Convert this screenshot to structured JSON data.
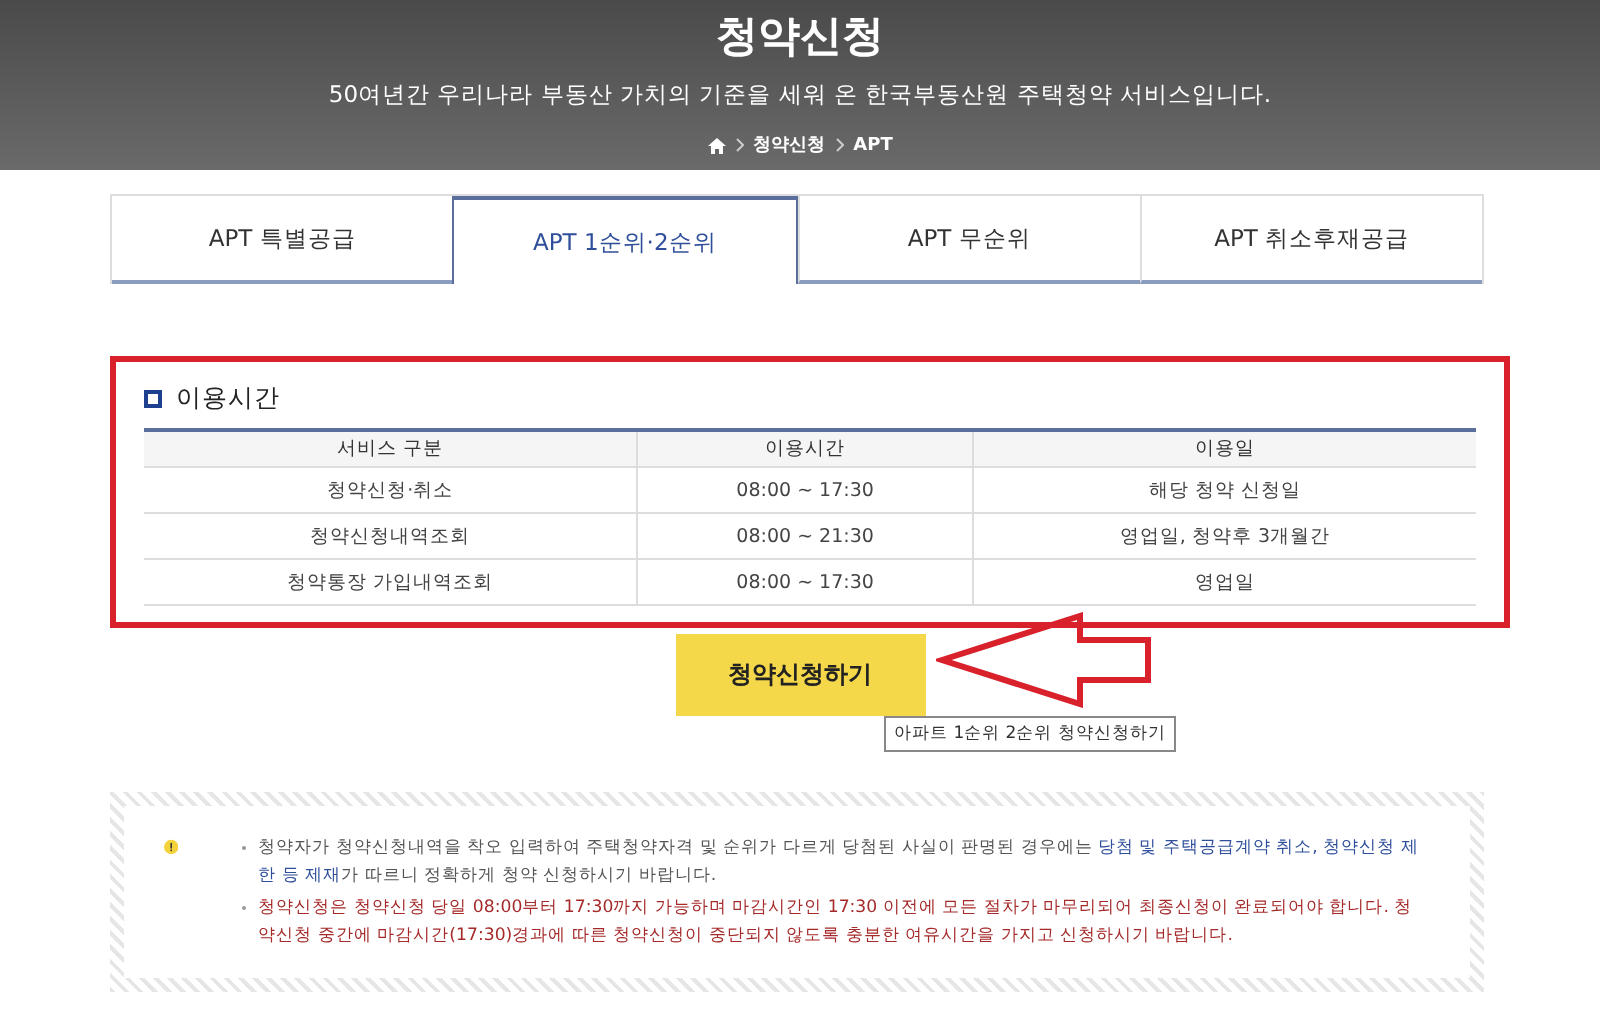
{
  "header": {
    "title": "청약신청",
    "subtitle": "50여년간 우리나라 부동산 가치의 기준을 세워 온 한국부동산원 주택청약 서비스입니다.",
    "breadcrumb": [
      "청약신청",
      "APT"
    ]
  },
  "tabs": [
    {
      "label": "APT 특별공급",
      "selected": false
    },
    {
      "label": "APT 1순위·2순위",
      "selected": true
    },
    {
      "label": "APT 무순위",
      "selected": false
    },
    {
      "label": "APT 취소후재공급",
      "selected": false
    }
  ],
  "usage": {
    "title": "이용시간",
    "columns": [
      "서비스 구분",
      "이용시간",
      "이용일"
    ],
    "rows": [
      [
        "청약신청·취소",
        "08:00 ~ 17:30",
        "해당 청약 신청일"
      ],
      [
        "청약신청내역조회",
        "08:00 ~ 21:30",
        "영업일, 청약후 3개월간"
      ],
      [
        "청약통장 가입내역조회",
        "08:00 ~ 17:30",
        "영업일"
      ]
    ]
  },
  "apply_button": "청약신청하기",
  "tooltip": "아파트 1순위 2순위 청약신청하기",
  "notices": [
    {
      "kind": "normal",
      "text": "청약자가 청약신청내역을 착오 입력하여 주택청약자격 및 순위가 다르게 당첨된 사실이 판명된 경우에는 **당첨 및 주택공급계약 취소, 청약신청 제한 등 제재**가 따르니 정확하게 청약 신청하시기 바랍니다."
    },
    {
      "kind": "warning",
      "text": "청약신청은 청약신청 당일 08:00부터 17:30까지 가능하며 마감시간인 17:30 이전에 모든 절차가 마무리되어 최종신청이 완료되어야 합니다. 청약신청 중간에 마감시간(17:30)경과에 따른 청약신청이 중단되지 않도록 충분한 여유시간을 가지고 신청하시기 바랍니다."
    }
  ]
}
